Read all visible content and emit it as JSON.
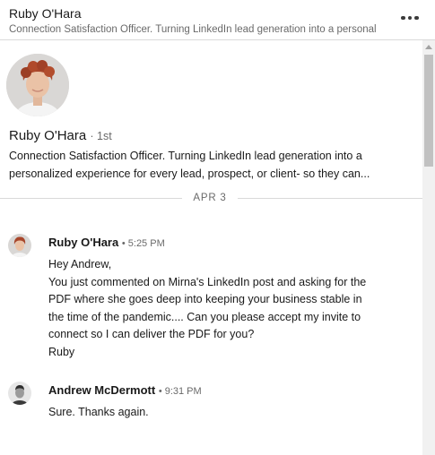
{
  "header": {
    "name": "Ruby O'Hara",
    "headline": "Connection Satisfaction Officer. Turning LinkedIn lead generation into a personal",
    "more_icon": "ellipsis-horizontal-icon"
  },
  "profile": {
    "name": "Ruby O'Hara",
    "degree": "· 1st",
    "headline_lines": [
      "Connection Satisfaction Officer. Turning LinkedIn lead generation into a",
      "personalized experience for every lead, prospect, or client- so they can..."
    ]
  },
  "date_divider": "APR 3",
  "messages": [
    {
      "sender": "Ruby O'Hara",
      "time": "• 5:25 PM",
      "lines": [
        "Hey Andrew,",
        "You just commented on Mirna's LinkedIn post and asking for the",
        "PDF where she goes deep into keeping your business stable in",
        "the time of the pandemic.... Can you please accept my invite to",
        "connect so I can deliver the PDF for you?",
        "Ruby"
      ]
    },
    {
      "sender": "Andrew McDermott",
      "time": "• 9:31 PM",
      "lines": [
        "Sure. Thanks again."
      ]
    }
  ],
  "colors": {
    "text_primary": "#1a1a1a",
    "text_secondary": "#666666",
    "divider": "#d9d9d9",
    "scrollbar_thumb": "#c1c1c1"
  }
}
